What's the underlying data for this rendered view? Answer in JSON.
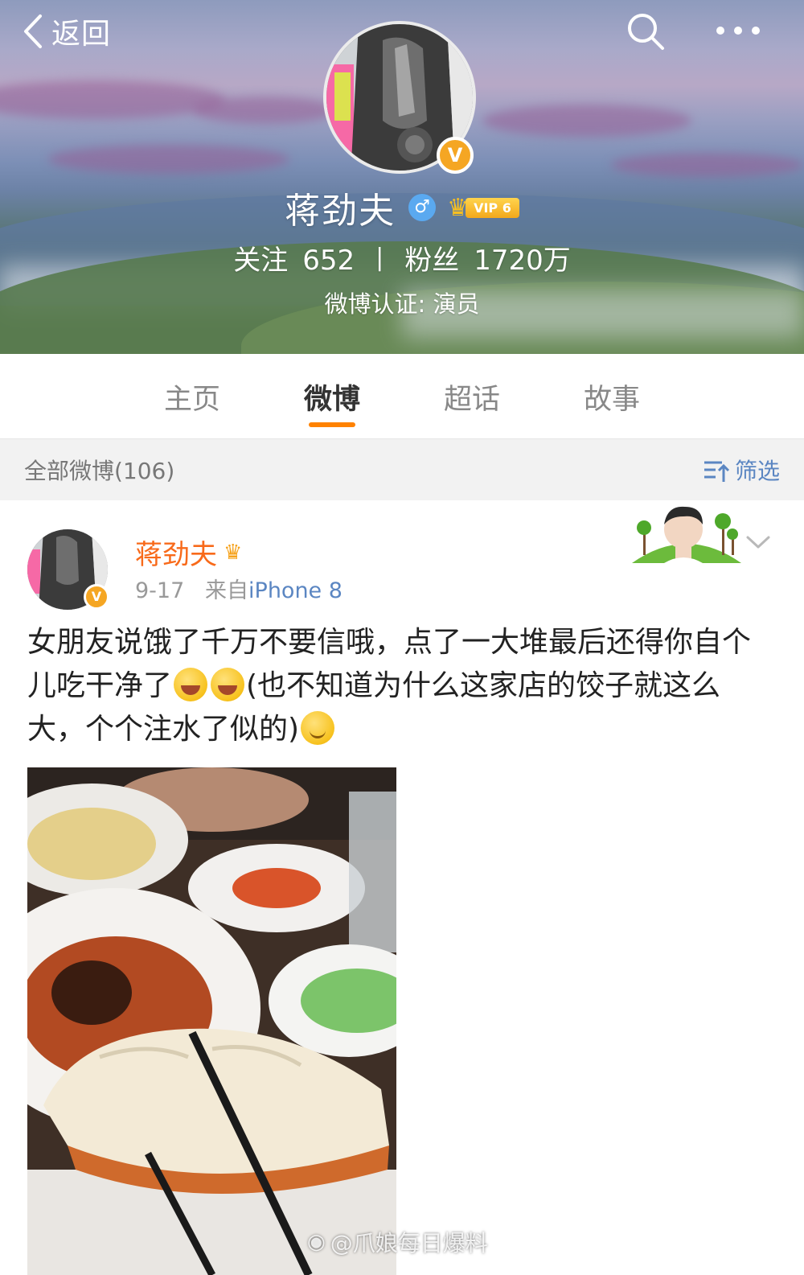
{
  "header": {
    "back_label": "返回",
    "name": "蒋劲夫",
    "gender_symbol": "♂",
    "vip_label": "VIP 6",
    "verified_mark": "V",
    "following_label": "关注",
    "following_count": "652",
    "separator": "|",
    "followers_label": "粉丝",
    "followers_count": "1720万",
    "verification": "微博认证: 演员"
  },
  "tabs": [
    {
      "label": "主页",
      "active": false
    },
    {
      "label": "微博",
      "active": true
    },
    {
      "label": "超话",
      "active": false
    },
    {
      "label": "故事",
      "active": false
    }
  ],
  "filter_bar": {
    "count_label": "全部微博(106)",
    "filter_label": "筛选"
  },
  "post": {
    "author": "蒋劲夫",
    "verified_mark": "V",
    "date": "9-17",
    "source_prefix": "来自",
    "source": "iPhone 8",
    "text_part1": "女朋友说饿了千万不要信哦，点了一大堆最后还得你自个儿吃干净了",
    "text_part2": "(也不知道为什么这家店的饺子就这么大，个个注水了似的)",
    "emojis": [
      "laugh-cry-emoji",
      "laugh-cry-emoji",
      "smile-emoji"
    ]
  },
  "watermark": "@爪娘每日爆料",
  "colors": {
    "accent": "#ff8200",
    "author_name": "#f86a1a",
    "link": "#5b86c2",
    "verified": "#f5a623"
  }
}
